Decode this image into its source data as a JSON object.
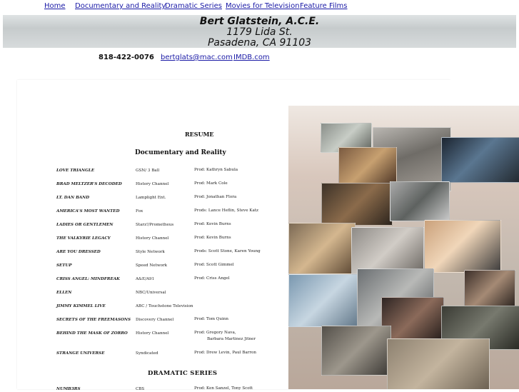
{
  "nav": {
    "home": "Home",
    "documentary": "Documentary and Reality",
    "dramatic": "Dramatic Series",
    "movies_tv": "Movies for Television",
    "feature": "Feature Films"
  },
  "header": {
    "name": "Bert Glatstein, A.C.E.",
    "street": "1179 Lida St.",
    "city": "Pasadena, CA 91103"
  },
  "contact": {
    "phone": "818-422-0076",
    "email": "bertglats@mac.com",
    "imdb": "IMDB.com"
  },
  "resume": {
    "title": "RESUME",
    "section1": "Documentary and Reality",
    "section2": "DRAMATIC SERIES",
    "entries": [
      {
        "title": "LOVE TRIANGLE",
        "network": "GSN/ 3 Ball",
        "producer": "Prod: Kathryn Sabula"
      },
      {
        "title": "BRAD MELTZER'S DECODED",
        "network": "History Channel",
        "producer": "Prod: Mark Cole"
      },
      {
        "title": "LT. DAN BAND",
        "network": "Lamplight Ent.",
        "producer": "Prod: Jonathan Flora"
      },
      {
        "title": "AMERICA'S MOST WANTED",
        "network": "Fox",
        "producer": "Prods: Lance Heflin, Steve Katz"
      },
      {
        "title": "LADIES OR GENTLEMEN",
        "network": "Starz!/Prometheus",
        "producer": "Prod: Kevin Burns"
      },
      {
        "title": "THE VALKYRIE LEGACY",
        "network": "History Channel",
        "producer": "Prod: Kevin Burns"
      },
      {
        "title": "ARE YOU DRESSED",
        "network": "Style Network",
        "producer": "Prods: Scott Stone, Karen Young"
      },
      {
        "title": "SETUP",
        "network": "Speed Network",
        "producer": "Prod: Scott Gimmel"
      },
      {
        "title": "CRISS ANGEL: MINDFREAK",
        "network": "A&E/A91",
        "producer": "Prod: Criss Angel"
      },
      {
        "title": "ELLEN",
        "network": "NBC/Universal",
        "producer": ""
      },
      {
        "title": "JIMMY KIMMEL LIVE",
        "network": "ABC / Touchstone Television",
        "producer": ""
      },
      {
        "title": "SECRETS OF THE FREEMASONS",
        "network": "Discovery Channel",
        "producer": "Prod: Tom Quinn"
      },
      {
        "title": "BEHIND THE MASK OF ZORRO",
        "network": "History Channel",
        "producer": "Prod: Gregory Nava,",
        "producer2": "Barbara Martinez Jitner"
      },
      {
        "title": "STRANGE UNIVERSE",
        "network": "Syndicated",
        "producer": "Prod: Drew Levin, Paul Barron"
      },
      {
        "title": "NUMB3RS",
        "network": "CBS",
        "producer": "Prod: Ken Sanzel, Tony Scott"
      }
    ]
  }
}
